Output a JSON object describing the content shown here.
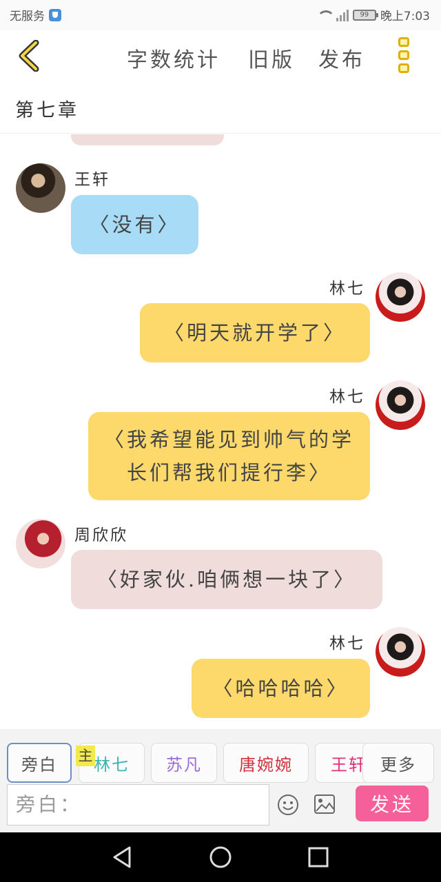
{
  "status_bar": {
    "carrier": "无服务",
    "battery": "99",
    "time": "晚上7:03"
  },
  "toolbar": {
    "word_count": "字数统计",
    "old_version": "旧版",
    "publish": "发布"
  },
  "chapter": {
    "title": "第七章"
  },
  "messages": [
    {
      "sender": "王轩",
      "text": "〈没有〉",
      "side": "left",
      "bubble_color": "#a8dcf6"
    },
    {
      "sender": "林七",
      "text": "〈明天就开学了〉",
      "side": "right",
      "bubble_color": "#fdd86b"
    },
    {
      "sender": "林七",
      "text": "〈我希望能见到帅气的学长们帮我们提行李〉",
      "side": "right",
      "bubble_color": "#fdd86b"
    },
    {
      "sender": "周欣欣",
      "text": "〈好家伙.咱俩想一块了〉",
      "side": "left",
      "bubble_color": "#f1dcdc"
    },
    {
      "sender": "林七",
      "text": "〈哈哈哈哈〉",
      "side": "right",
      "bubble_color": "#fdd86b"
    }
  ],
  "roles": [
    {
      "label": "旁白",
      "color": "#555555"
    },
    {
      "label": "林七",
      "color": "#3bb4b4"
    },
    {
      "label": "苏凡",
      "color": "#9b6bd6"
    },
    {
      "label": "唐婉婉",
      "color": "#d0303a"
    },
    {
      "label": "王轩",
      "color": "#e0307a"
    },
    {
      "label": "更多",
      "color": "#555555"
    }
  ],
  "main_tag": "主",
  "input": {
    "prefix": "旁白："
  },
  "send_label": "发送",
  "colors": {
    "accent": "#f6609a",
    "more_icon": "#e0b000"
  }
}
